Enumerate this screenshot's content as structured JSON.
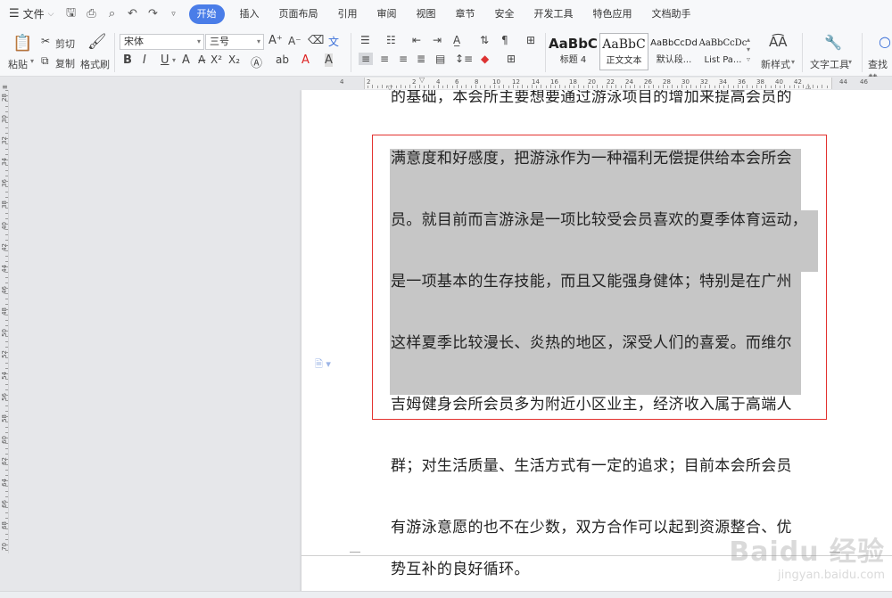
{
  "menubar": {
    "file_label": "文件",
    "tabs": [
      "开始",
      "插入",
      "页面布局",
      "引用",
      "审阅",
      "视图",
      "章节",
      "安全",
      "开发工具",
      "特色应用",
      "文档助手"
    ],
    "active_tab": "开始"
  },
  "ribbon": {
    "paste_label": "粘贴",
    "cut_label": "剪切",
    "copy_label": "复制",
    "format_painter_label": "格式刷",
    "font_name": "宋体",
    "font_size": "三号",
    "styles": [
      {
        "sample": "AaBbC",
        "name": "标题 4"
      },
      {
        "sample": "AaBbC",
        "name": "正文文本"
      },
      {
        "sample": "AaBbCcDd",
        "name": "默认段..."
      },
      {
        "sample": "AaBbCcDc",
        "name": "List Pa..."
      }
    ],
    "new_style_label": "新样式",
    "text_tools_label": "文字工具",
    "find_replace_label": "查找替"
  },
  "ruler": {
    "h_numbers": [
      "4",
      "2",
      "2",
      "4",
      "6",
      "8",
      "10",
      "12",
      "14",
      "16",
      "18",
      "20",
      "22",
      "24",
      "26",
      "28",
      "30",
      "32",
      "34",
      "36",
      "38",
      "40",
      "42",
      "44",
      "46"
    ],
    "v_numbers": [
      "28",
      "30",
      "32",
      "34",
      "36",
      "38",
      "40",
      "42",
      "44",
      "46",
      "48",
      "50",
      "52",
      "54",
      "56",
      "58",
      "60",
      "62",
      "64",
      "66",
      "68",
      "70"
    ]
  },
  "document": {
    "lines": [
      "的基础，本会所主要想要通过游泳项目的增加来提高会员的",
      "满意度和好感度，把游泳作为一种福利无偿提供给本会所会",
      "员。就目前而言游泳是一项比较受会员喜欢的夏季体育运动，",
      "是一项基本的生存技能，而且又能强身健体；特别是在广州",
      "这样夏季比较漫长、炎热的地区，深受人们的喜爱。而维尔",
      "吉姆健身会所会员多为附近小区业主，经济收入属于高端人",
      "群；对生活质量、生活方式有一定的追求；目前本会所会员",
      "有游泳意愿的也不在少数，双方合作可以起到资源整合、优",
      "势互补的良好循环。"
    ]
  },
  "watermark": {
    "brand": "Baidu 经验",
    "url": "jingyan.baidu.com"
  },
  "colors": {
    "accent": "#4a7de8",
    "selection": "#c6c6c6",
    "annotation_box": "#e3322f"
  }
}
